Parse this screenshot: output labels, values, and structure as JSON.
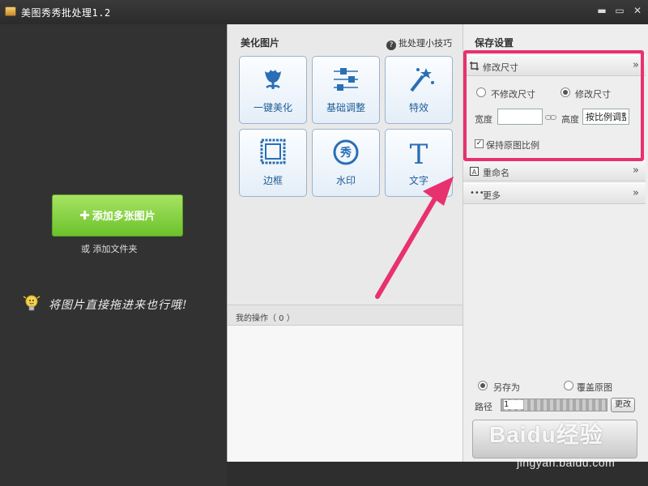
{
  "window": {
    "title": "美图秀秀批处理1.2",
    "controls": [
      "▬",
      "▭",
      "✕"
    ]
  },
  "left": {
    "add_button": "添加多张图片",
    "add_folder": "或 添加文件夹",
    "drag_hint": "将图片直接拖进来也行哦!"
  },
  "tools": {
    "title": "美化图片",
    "tips": "批处理小技巧",
    "items": [
      {
        "label": "一键美化",
        "icon": "tulip-icon"
      },
      {
        "label": "基础调整",
        "icon": "sliders-icon"
      },
      {
        "label": "特效",
        "icon": "magic-wand-icon"
      },
      {
        "label": "边框",
        "icon": "frame-icon"
      },
      {
        "label": "水印",
        "icon": "watermark-icon"
      },
      {
        "label": "文字",
        "icon": "text-icon"
      }
    ],
    "watermark_glyph": "秀",
    "text_glyph": "T",
    "ops_label": "我的操作（ 0 ）"
  },
  "save": {
    "title": "保存设置",
    "resize": {
      "label": "修改尺寸",
      "no_resize": "不修改尺寸",
      "do_resize": "修改尺寸",
      "selected": "do_resize",
      "width_label": "宽度",
      "width_value": "",
      "height_label": "高度",
      "height_value": "按比例调整",
      "keep_ratio_label": "保持原图比例",
      "keep_ratio_checked": true
    },
    "rename_label": "重命名",
    "more_label": "更多",
    "save_as": "另存为",
    "overwrite": "覆盖原图",
    "save_mode": "save_as",
    "path_label": "路径",
    "path_value": "1",
    "change_button": "更改"
  },
  "watermark": {
    "logo": "Baidu经验",
    "url": "jingyan.baidu.com"
  },
  "colors": {
    "accent_green": "#6cc22c",
    "highlight_pink": "#e8316f",
    "tool_blue": "#1f5d96"
  }
}
